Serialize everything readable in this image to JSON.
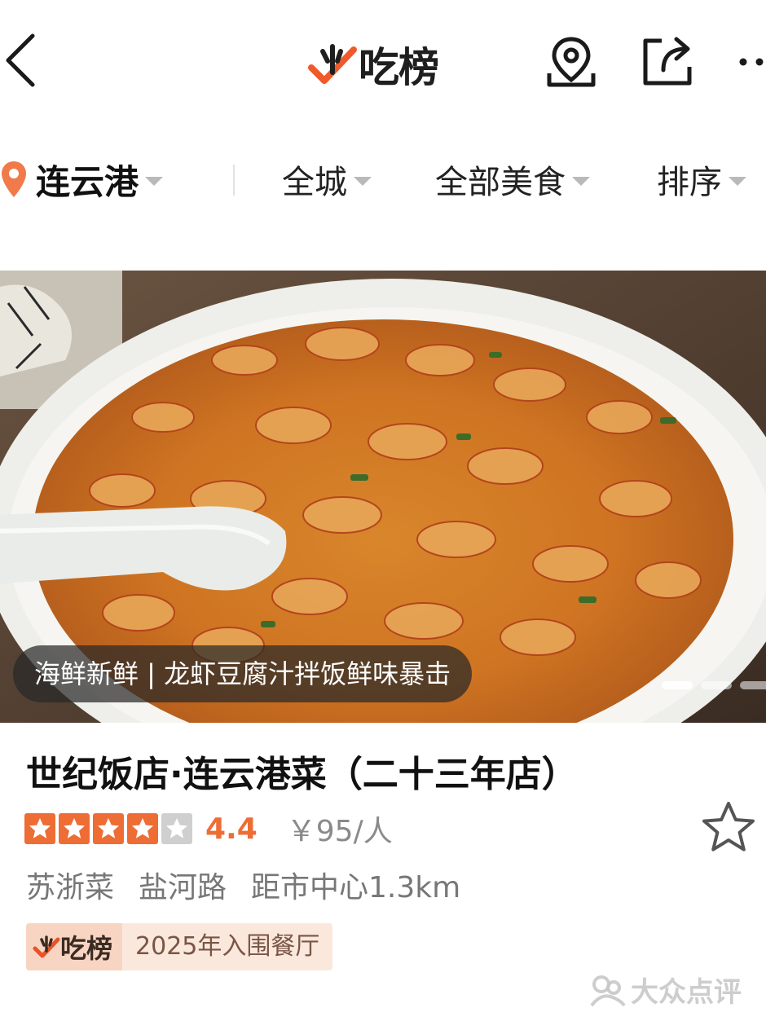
{
  "header": {
    "logo_text": "吃榜",
    "icons": [
      "back-arrow-icon",
      "map-pin-outline-icon",
      "share-icon",
      "more-icon"
    ]
  },
  "filters": {
    "city": "连云港",
    "area": "全城",
    "category": "全部美食",
    "sort": "排序"
  },
  "photo": {
    "caption": "海鲜新鲜 | 龙虾豆腐汁拌饭鲜味暴击",
    "page_count": 3,
    "active_page": 1
  },
  "restaurant": {
    "name": "世纪饭店·连云港菜（二十三年店）",
    "stars_filled": 4,
    "stars_total": 5,
    "score": "4.4",
    "price": "￥95/人",
    "cuisine": "苏浙菜",
    "street": "盐河路",
    "distance": "距市中心1.3km"
  },
  "badge": {
    "logo_text": "吃榜",
    "text": "2025年入围餐厅"
  },
  "watermark": {
    "text": "大众点评"
  },
  "colors": {
    "accent": "#ee6d35",
    "pin": "#f07a4a",
    "badge_bg": "#fbe8dd"
  }
}
